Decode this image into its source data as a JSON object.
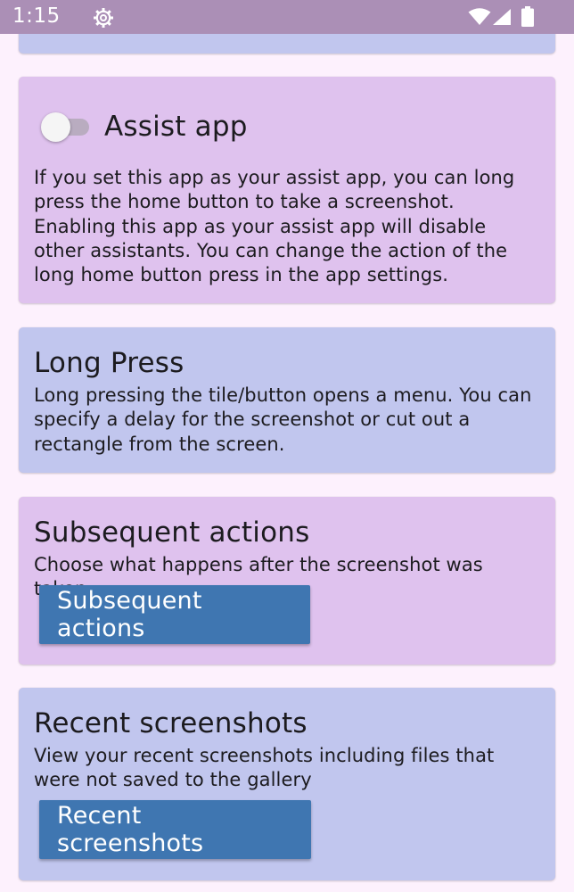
{
  "status_bar": {
    "time": "1:15",
    "icons": [
      "settings-gear-icon",
      "wifi-icon",
      "cell-signal-icon",
      "battery-icon"
    ],
    "background": "#ab8fb6"
  },
  "cards": {
    "assist": {
      "title": "Assist app",
      "toggle_on": false,
      "description": "If you set this app as your assist app, you can long press the home button to take a screenshot. Enabling this app as your assist app will disable other assistants. You can change the action of the long home button press in the app settings."
    },
    "long_press": {
      "title": "Long Press",
      "description": "Long pressing the tile/button opens a menu. You can specify a delay for the screenshot or cut out a rectangle from the screen."
    },
    "subsequent": {
      "title": "Subsequent actions",
      "description": "Choose what happens after the screenshot was taken",
      "button_label": "Subsequent actions"
    },
    "recent": {
      "title": "Recent screenshots",
      "description": "View your recent screenshots including files that were not saved to the gallery",
      "button_label": "Recent screenshots"
    }
  },
  "colors": {
    "card_blue": "#c1c6ee",
    "card_purple": "#dfc2ee",
    "button": "#3f76b1",
    "page_background": "#fdf1fd"
  }
}
